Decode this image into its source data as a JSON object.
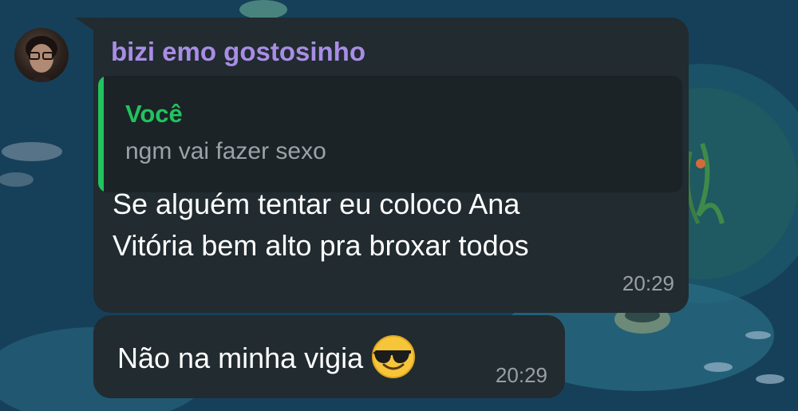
{
  "chat": {
    "incoming": {
      "sender": "bizi emo gostosinho",
      "reply_to": {
        "author": "Você",
        "text": "ngm vai fazer sexo"
      },
      "text_line1": "Se alguém tentar eu coloco Ana",
      "text_line2": "Vitória bem alto pra broxar todos",
      "time": "20:29"
    },
    "followup": {
      "text": "Não na minha vigia",
      "emoji": "smiling-face-with-sunglasses",
      "time": "20:29"
    }
  },
  "colors": {
    "bubble": "#212b30",
    "sender_name": "#a98de5",
    "reply_accent": "#22c35e",
    "timestamp": "#98a0a5"
  }
}
